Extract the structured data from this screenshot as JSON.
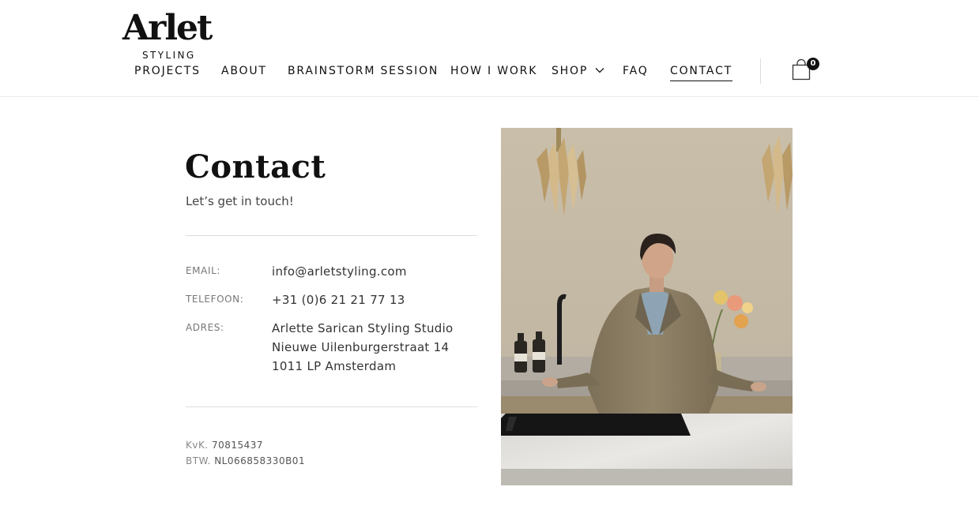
{
  "brand": {
    "name": "Arlet",
    "tagline": "STYLING"
  },
  "nav": {
    "items": [
      {
        "label": "PROJECTS"
      },
      {
        "label": "ABOUT"
      },
      {
        "label": "BRAINSTORM SESSION"
      },
      {
        "label": "HOW I WORK"
      },
      {
        "label": "SHOP"
      },
      {
        "label": "FAQ"
      },
      {
        "label": "CONTACT"
      }
    ],
    "active": "CONTACT"
  },
  "cart": {
    "count": "0",
    "icon": "shopping-bag-icon"
  },
  "contact": {
    "title": "Contact",
    "subtitle": "Let’s get in touch!",
    "email_label": "EMAIL:",
    "email_value": "info@arletstyling.com",
    "phone_label": "TELEFOON:",
    "phone_value": "+31 (0)6 21 21 77 13",
    "address_label": "ADRES:",
    "address_lines": [
      "Arlette Sarican Styling Studio",
      "Nieuwe Uilenburgerstraat 14",
      "1011 LP Amsterdam"
    ],
    "kvk_label": "KvK.",
    "kvk_value": "70815437",
    "btw_label": "BTW.",
    "btw_value": "NL066858330B01"
  },
  "colors": {
    "text": "#111111",
    "muted": "#777777",
    "rule": "#dedede",
    "wall": "#c5bba9",
    "jacket": "#8a7c64"
  }
}
